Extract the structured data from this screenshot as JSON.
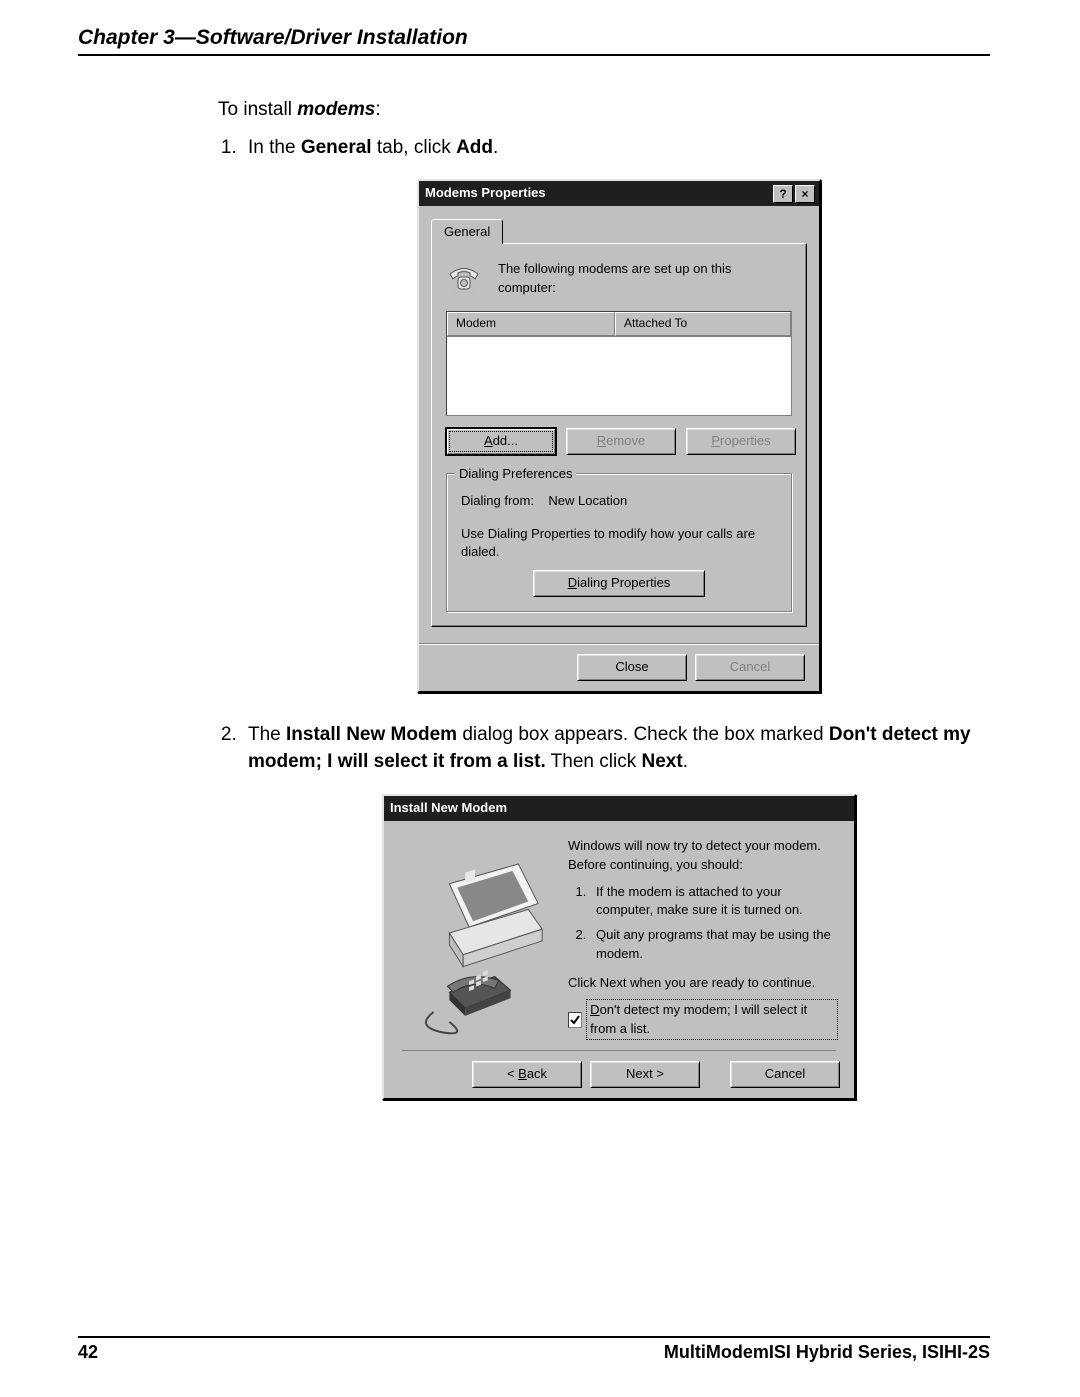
{
  "header": {
    "chapter_title": "Chapter 3—Software/Driver Installation"
  },
  "intro": {
    "prefix": "To install ",
    "emph": "modems",
    "suffix": ":"
  },
  "steps": {
    "s1_a": "In the ",
    "s1_b": "General",
    "s1_c": " tab, click ",
    "s1_d": "Add",
    "s1_e": ".",
    "s2_a": "The ",
    "s2_b": "Install New Modem",
    "s2_c": " dialog box appears. Check the box marked ",
    "s2_d": "Don't detect my modem; I will select it from a list.",
    "s2_e": " Then click ",
    "s2_f": "Next",
    "s2_g": "."
  },
  "dialog1": {
    "title": "Modems Properties",
    "help_label": "?",
    "close_label": "×",
    "tab_general": "General",
    "summary": "The following modems are set up on this computer:",
    "col_modem": "Modem",
    "col_attached": "Attached To",
    "btn_add_u": "A",
    "btn_add_rest": "dd...",
    "btn_remove_u": "R",
    "btn_remove_rest": "emove",
    "btn_props_u": "P",
    "btn_props_rest": "roperties",
    "group_title": "Dialing Preferences",
    "dial_from_label": "Dialing from:",
    "dial_from_value": "New Location",
    "dial_hint": "Use Dialing Properties to modify how your calls are dialed.",
    "btn_dialprops_u": "D",
    "btn_dialprops_rest": "ialing Properties",
    "btn_close": "Close",
    "btn_cancel": "Cancel"
  },
  "dialog2": {
    "title": "Install New Modem",
    "intro": "Windows will now try to detect your modem.  Before continuing, you should:",
    "li1": "If the modem is attached to your computer, make sure it is turned on.",
    "li2": "Quit any programs that may be using the modem.",
    "ready_line": "Click Next when you are ready to continue.",
    "chk_u": "D",
    "chk_rest": "on't detect my modem; I will select it from a list.",
    "btn_back_lt": "< ",
    "btn_back_u": "B",
    "btn_back_rest": "ack",
    "btn_next_pre": "Next ",
    "btn_next_gt": ">",
    "btn_cancel": "Cancel"
  },
  "footer": {
    "page_number": "42",
    "product": "MultiModemISI Hybrid Series, ISIHI-2S"
  }
}
